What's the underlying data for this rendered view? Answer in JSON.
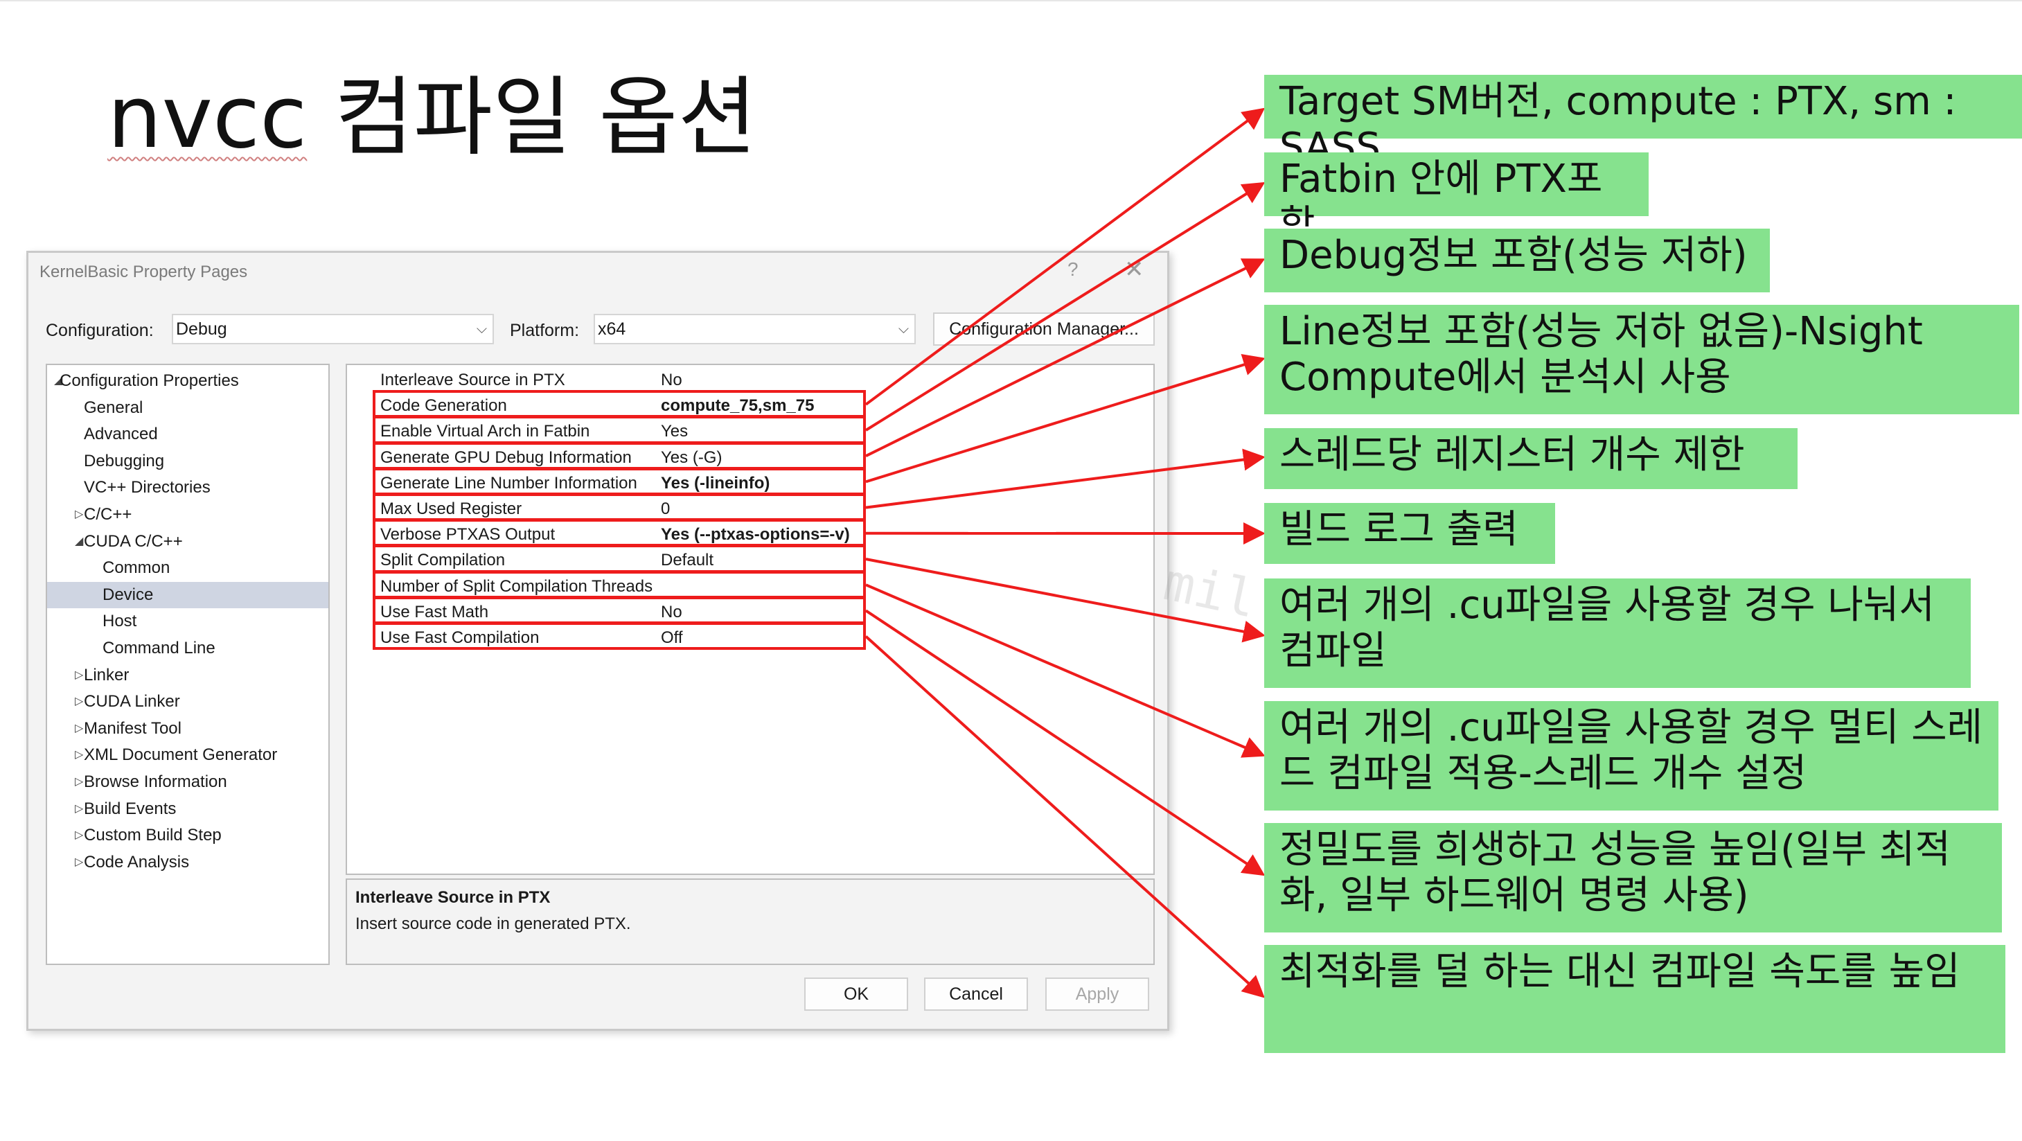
{
  "slide": {
    "title_word1": "nvcc",
    "title_word2": "컴파일 옵션"
  },
  "dialog": {
    "title": "KernelBasic Property Pages",
    "help_glyph": "?",
    "close_glyph": "✕",
    "configuration_label": "Configuration:",
    "configuration_value": "Debug",
    "platform_label": "Platform:",
    "platform_value": "x64",
    "config_manager_label": "Configuration Manager...",
    "tree": [
      {
        "label": "Configuration Properties",
        "arrow": "◢",
        "sel": false
      },
      {
        "label": "General",
        "arrow": "",
        "sel": false
      },
      {
        "label": "Advanced",
        "arrow": "",
        "sel": false
      },
      {
        "label": "Debugging",
        "arrow": "",
        "sel": false
      },
      {
        "label": "VC++ Directories",
        "arrow": "",
        "sel": false
      },
      {
        "label": "C/C++",
        "arrow": "▷",
        "sel": false
      },
      {
        "label": "CUDA C/C++",
        "arrow": "◢",
        "sel": false
      },
      {
        "label": "Common",
        "arrow": "",
        "sel": false
      },
      {
        "label": "Device",
        "arrow": "",
        "sel": true
      },
      {
        "label": "Host",
        "arrow": "",
        "sel": false
      },
      {
        "label": "Command Line",
        "arrow": "",
        "sel": false
      },
      {
        "label": "Linker",
        "arrow": "▷",
        "sel": false
      },
      {
        "label": "CUDA Linker",
        "arrow": "▷",
        "sel": false
      },
      {
        "label": "Manifest Tool",
        "arrow": "▷",
        "sel": false
      },
      {
        "label": "XML Document Generator",
        "arrow": "▷",
        "sel": false
      },
      {
        "label": "Browse Information",
        "arrow": "▷",
        "sel": false
      },
      {
        "label": "Build Events",
        "arrow": "▷",
        "sel": false
      },
      {
        "label": "Custom Build Step",
        "arrow": "▷",
        "sel": false
      },
      {
        "label": "Code Analysis",
        "arrow": "▷",
        "sel": false
      }
    ],
    "properties": [
      {
        "name": "Interleave Source in PTX",
        "value": "No",
        "bold": false
      },
      {
        "name": "Code Generation",
        "value": "compute_75,sm_75",
        "bold": true
      },
      {
        "name": "Enable Virtual Arch in Fatbin",
        "value": "Yes",
        "bold": false
      },
      {
        "name": "Generate GPU Debug Information",
        "value": "Yes (-G)",
        "bold": false
      },
      {
        "name": "Generate Line Number Information",
        "value": "Yes (-lineinfo)",
        "bold": true
      },
      {
        "name": "Max Used Register",
        "value": "0",
        "bold": false
      },
      {
        "name": "Verbose PTXAS Output",
        "value": "Yes (--ptxas-options=-v)",
        "bold": true
      },
      {
        "name": "Split Compilation",
        "value": "Default",
        "bold": false
      },
      {
        "name": "Number of Split Compilation Threads",
        "value": "",
        "bold": false
      },
      {
        "name": "Use Fast Math",
        "value": "No",
        "bold": false
      },
      {
        "name": "Use Fast Compilation",
        "value": "Off",
        "bold": false
      }
    ],
    "description_title": "Interleave Source in PTX",
    "description_text": "Insert source code in generated PTX.",
    "ok_label": "OK",
    "cancel_label": "Cancel",
    "apply_label": "Apply"
  },
  "watermark_text": "mil",
  "callouts": [
    "Target SM버전, compute : PTX, sm : SASS",
    "Fatbin 안에 PTX포함",
    "Debug정보 포함(성능 저하)",
    "Line정보 포함(성능 저하 없음)-Nsight Compute에서 분석시 사용",
    "스레드당 레지스터 개수 제한",
    "빌드 로그 출력",
    "여러 개의 .cu파일을 사용할 경우 나눠서 컴파일",
    "여러 개의 .cu파일을 사용할 경우 멀티 스레드 컴파일 적용-스레드 개수 설정",
    "정밀도를 희생하고 성능을 높임(일부 최적화, 일부 하드웨어 명령 사용)",
    "최적화를 덜 하는 대신 컴파일 속도를 높임"
  ],
  "colors": {
    "callout_bg": "#86e28e",
    "highlight_red": "#ee1c1c",
    "tree_selection": "#cfd5e2"
  }
}
